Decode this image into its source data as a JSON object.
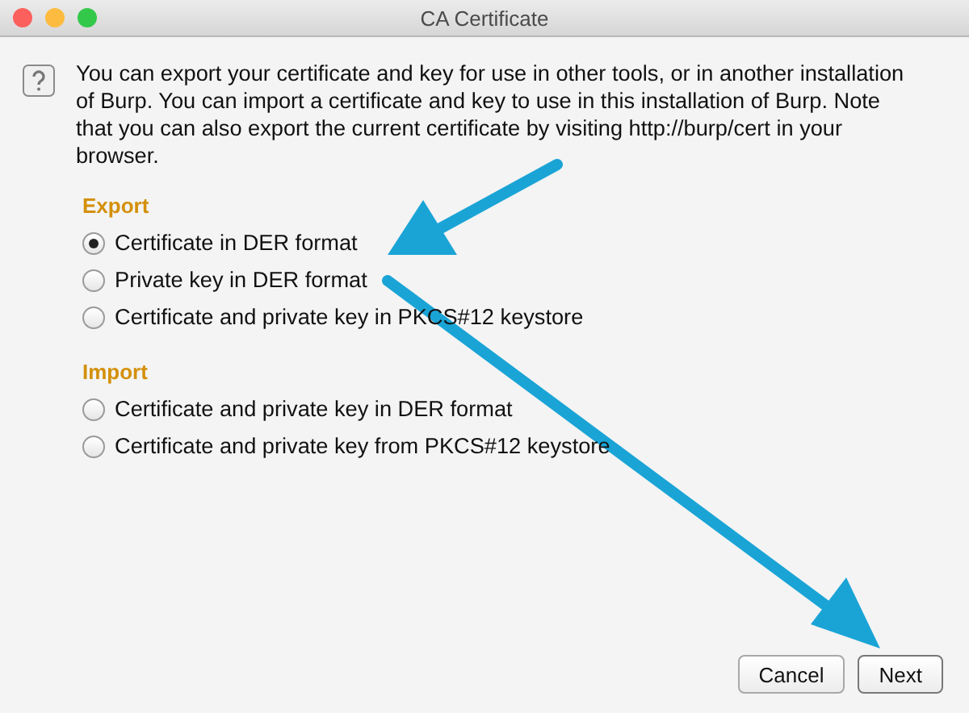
{
  "window": {
    "title": "CA Certificate"
  },
  "message": "You can export your certificate and key for use in other tools, or in another installation of Burp. You can import a certificate and key to use in this installation of Burp. Note that you can also export the current certificate by visiting http://burp/cert in your browser.",
  "sections": [
    {
      "heading": "Export",
      "options": [
        {
          "label": "Certificate in DER format",
          "selected": true
        },
        {
          "label": "Private key in DER format",
          "selected": false
        },
        {
          "label": "Certificate and private key in PKCS#12 keystore",
          "selected": false
        }
      ]
    },
    {
      "heading": "Import",
      "options": [
        {
          "label": "Certificate and private key in DER format",
          "selected": false
        },
        {
          "label": "Certificate and private key from PKCS#12 keystore",
          "selected": false
        }
      ]
    }
  ],
  "buttons": [
    {
      "label": "Cancel",
      "kind": "secondary"
    },
    {
      "label": "Next",
      "kind": "default"
    }
  ]
}
